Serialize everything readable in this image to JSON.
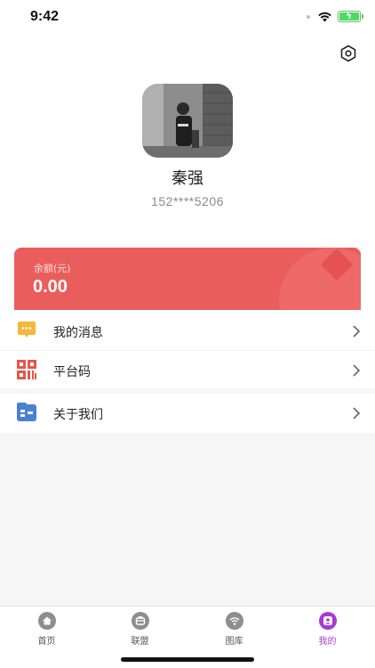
{
  "status_bar": {
    "time": "9:42"
  },
  "profile": {
    "name": "秦强",
    "phone": "152****5206",
    "settings_icon": "settings-hexagon-icon",
    "avatar_icon": "avatar-photo"
  },
  "balance": {
    "label": "余额(元)",
    "value": "0.00",
    "color": "#ea5d5d"
  },
  "menu": {
    "group1": [
      {
        "label": "我的消息",
        "icon": "message-icon",
        "icon_color": "#f2b83b"
      },
      {
        "label": "平台码",
        "icon": "qr-code-icon",
        "icon_color": "#e2574c"
      }
    ],
    "group2": [
      {
        "label": "关于我们",
        "icon": "about-us-icon",
        "icon_color": "#4a7fd1"
      }
    ]
  },
  "tab_bar": {
    "active_color": "#a83ad4",
    "tabs": [
      {
        "label": "首页",
        "icon": "home-icon",
        "active": false
      },
      {
        "label": "联盟",
        "icon": "alliance-icon",
        "active": false
      },
      {
        "label": "图库",
        "icon": "gallery-icon",
        "active": false
      },
      {
        "label": "我的",
        "icon": "profile-icon",
        "active": true
      }
    ]
  }
}
